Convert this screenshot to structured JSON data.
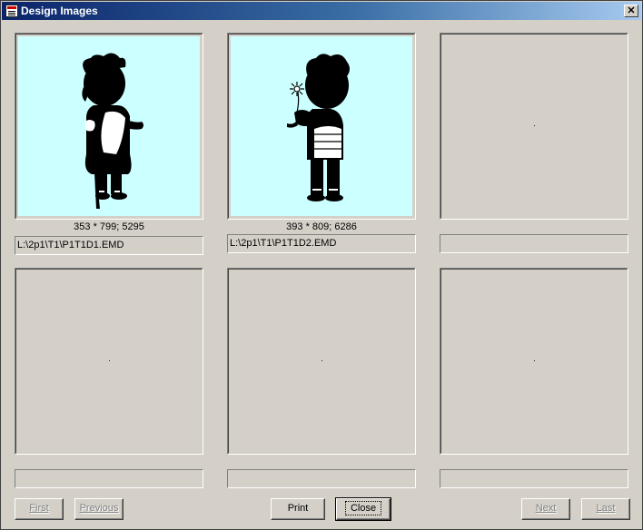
{
  "window": {
    "title": "Design Images"
  },
  "images": [
    {
      "caption": "353 * 799; 5295",
      "path": "L:\\2p1\\T1\\P1T1D1.EMD"
    },
    {
      "caption": "393 * 809; 6286",
      "path": "L:\\2p1\\T1\\P1T1D2.EMD"
    },
    {
      "caption": "",
      "path": ""
    },
    {
      "caption": "",
      "path": ""
    },
    {
      "caption": "",
      "path": ""
    },
    {
      "caption": "",
      "path": ""
    }
  ],
  "buttons": {
    "first": "First",
    "previous": "Previous",
    "print": "Print",
    "close": "Close",
    "next": "Next",
    "last": "Last"
  },
  "colors": {
    "title_bar": "#0a246a",
    "image_background": "#ccffff",
    "dialog": "#d4d0c8"
  }
}
